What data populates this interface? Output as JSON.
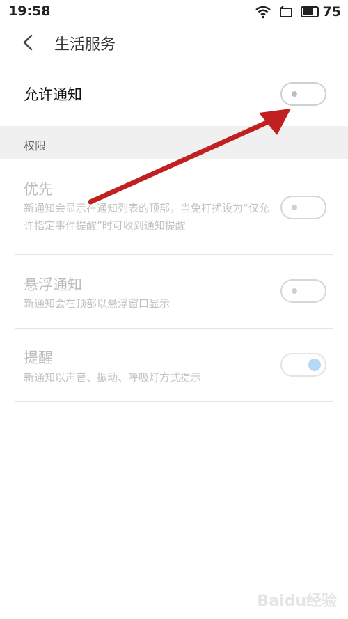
{
  "status_bar": {
    "time": "19:58",
    "battery": "75"
  },
  "header": {
    "title": "生活服务",
    "back_icon": "chevron-left-icon"
  },
  "allow_notification": {
    "label": "允许通知",
    "enabled": false
  },
  "permissions_section": {
    "label": "权限"
  },
  "items": [
    {
      "title": "优先",
      "desc": "新通知会显示在通知列表的顶部，当免打扰设为“仅允许指定事件提醒”时可收到通知提醒",
      "enabled": false
    },
    {
      "title": "悬浮通知",
      "desc": "新通知会在顶部以悬浮窗口显示",
      "enabled": false
    },
    {
      "title": "提醒",
      "desc": "新通知以声音、振动、呼吸灯方式提示",
      "enabled": true
    }
  ],
  "watermark": "Baidu经验",
  "colors": {
    "annotation_arrow": "#c0201f",
    "toggle_on_knob": "#b7d7f7"
  }
}
